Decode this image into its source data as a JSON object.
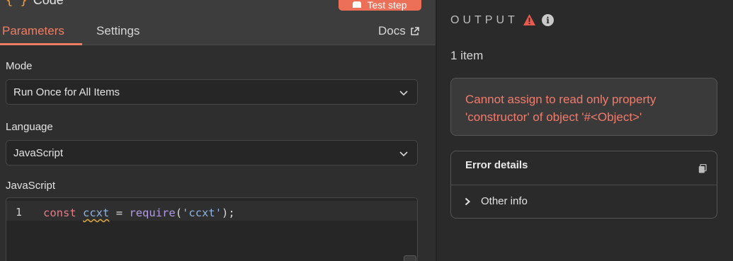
{
  "node": {
    "title": "Code",
    "title_icon": "{ }",
    "test_button_label": "Test step"
  },
  "tabs": {
    "parameters": "Parameters",
    "settings": "Settings",
    "docs": "Docs"
  },
  "fields": {
    "mode_label": "Mode",
    "mode_value": "Run Once for All Items",
    "language_label": "Language",
    "language_value": "JavaScript",
    "code_label": "JavaScript"
  },
  "editor": {
    "line_number": "1",
    "tokens": {
      "kw": "const",
      "var": "ccxt",
      "op": "=",
      "fn": "require",
      "open": "(",
      "str": "'ccxt'",
      "close": ");"
    }
  },
  "output": {
    "heading": "OUTPUT",
    "item_count": "1 item",
    "error_line1": "Cannot assign to read only property",
    "error_line2": "'constructor' of object '#<Object>'",
    "details_title": "Error details",
    "other_info": "Other info"
  },
  "colors": {
    "accent": "#ef7d63",
    "error_text": "#f27b6b",
    "warning": "#e8594f"
  }
}
